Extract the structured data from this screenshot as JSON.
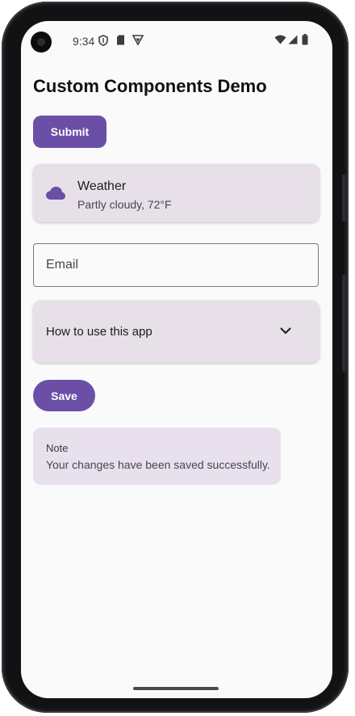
{
  "statusbar": {
    "time": "9:34",
    "icons_left": [
      "shield-icon",
      "sim-card-icon",
      "vpn-icon"
    ],
    "icons_right": [
      "wifi-icon",
      "signal-icon",
      "battery-icon"
    ]
  },
  "page": {
    "title": "Custom Components Demo"
  },
  "submit_button": {
    "label": "Submit"
  },
  "weather_card": {
    "icon": "cloud-icon",
    "title": "Weather",
    "description": "Partly cloudy, 72°F"
  },
  "email_field": {
    "placeholder": "Email",
    "value": ""
  },
  "accordion": {
    "label": "How to use this app",
    "icon": "chevron-down-icon",
    "expanded": false
  },
  "save_button": {
    "label": "Save"
  },
  "note": {
    "title": "Note",
    "body": "Your changes have been saved successfully."
  },
  "colors": {
    "primary": "#6b4fa6",
    "card_surface": "#e7e0e8",
    "note_surface": "#e9e0ee",
    "background": "#fafafa",
    "outline": "#79747e"
  }
}
